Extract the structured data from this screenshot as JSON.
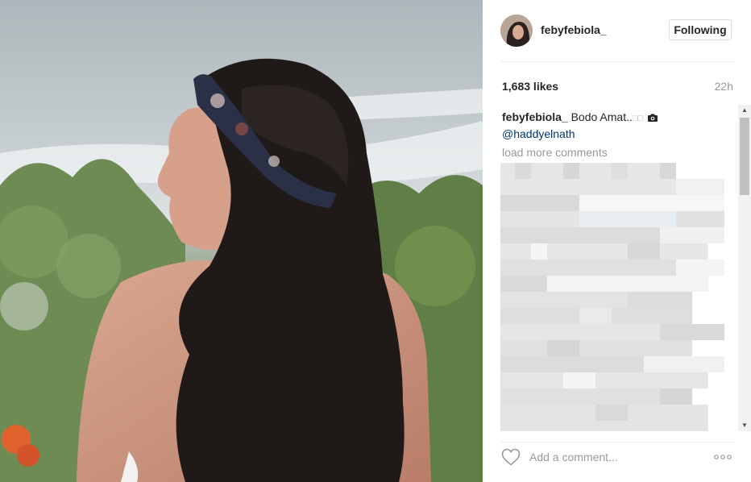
{
  "post": {
    "username": "febyfebiola_",
    "follow_button_label": "Following",
    "likes": "1,683 likes",
    "time_ago": "22h",
    "caption": {
      "username": "febyfebiola_",
      "text": "Bodo Amat..",
      "emoji_placeholder": "□□",
      "camera_icon": "camera-icon",
      "mention": "@haddyelnath"
    },
    "load_more": "load more comments",
    "comment_placeholder": "Add a comment...",
    "icons": {
      "like": "heart-outline-icon",
      "more": "more-options-icon",
      "scroll_up": "arrow-up-icon",
      "scroll_down": "arrow-down-icon"
    }
  },
  "colors": {
    "text": "#262626",
    "muted": "#999999",
    "mention": "#003569",
    "border": "#dbdbdb"
  }
}
